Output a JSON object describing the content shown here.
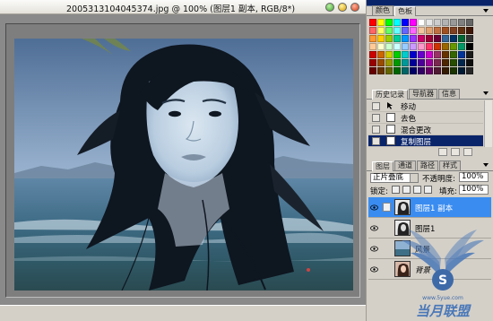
{
  "document": {
    "title": "2005313104045374.jpg @ 100% (图层1 副本, RGB/8*)"
  },
  "swatches_panel": {
    "tabs": [
      "颜色",
      "色板"
    ],
    "active_tab": "色板",
    "colors": [
      "#ff0000",
      "#ffff00",
      "#00ff00",
      "#00ffff",
      "#0000ff",
      "#ff00ff",
      "#ffffff",
      "#e6e6e6",
      "#cccccc",
      "#b3b3b3",
      "#999999",
      "#808080",
      "#666666",
      "#ff6666",
      "#ffff66",
      "#66ff66",
      "#66ffff",
      "#6666ff",
      "#ff66ff",
      "#f2c6a0",
      "#e0a070",
      "#c07040",
      "#a05020",
      "#804020",
      "#603010",
      "#401808",
      "#ff9933",
      "#ffcc00",
      "#99cc00",
      "#00cc99",
      "#0099ff",
      "#9933ff",
      "#cc0066",
      "#990033",
      "#660033",
      "#336699",
      "#003366",
      "#006633",
      "#333333",
      "#ffcc99",
      "#ffffcc",
      "#ccffcc",
      "#ccffff",
      "#99ccff",
      "#cc99ff",
      "#ff99cc",
      "#ff3366",
      "#cc3300",
      "#996600",
      "#669900",
      "#009966",
      "#000000",
      "#cc0000",
      "#cc6600",
      "#cccc00",
      "#00cc00",
      "#00cccc",
      "#0000cc",
      "#6600cc",
      "#cc00cc",
      "#993366",
      "#663300",
      "#336600",
      "#003399",
      "#1a1a1a",
      "#990000",
      "#994c00",
      "#999900",
      "#009900",
      "#009999",
      "#000099",
      "#4c0099",
      "#990099",
      "#7a2850",
      "#4d2600",
      "#264d00",
      "#00264d",
      "#0d0d0d",
      "#660000",
      "#663300",
      "#666600",
      "#006600",
      "#006666",
      "#000066",
      "#330066",
      "#660066",
      "#501a34",
      "#331a00",
      "#1a3300",
      "#001a33",
      "#262626"
    ]
  },
  "history_panel": {
    "tabs": [
      "历史记录",
      "导航器",
      "信息"
    ],
    "active_tab": "历史记录",
    "items": [
      {
        "label": "移动",
        "selected": false
      },
      {
        "label": "去色",
        "selected": false
      },
      {
        "label": "混合更改",
        "selected": false
      },
      {
        "label": "复制图层",
        "selected": true
      }
    ]
  },
  "layers_panel": {
    "tabs": [
      "图层",
      "通道",
      "路径",
      "样式"
    ],
    "active_tab": "图层",
    "blend_mode": "正片叠底",
    "opacity_label": "不透明度:",
    "opacity_value": "100%",
    "lock_label": "锁定:",
    "fill_label": "填充:",
    "fill_value": "100%",
    "layers": [
      {
        "name": "图层1 副本",
        "selected": true,
        "italic": false
      },
      {
        "name": "图层1",
        "selected": false,
        "italic": false
      },
      {
        "name": "风景",
        "selected": false,
        "italic": false
      },
      {
        "name": "背景",
        "selected": false,
        "italic": true
      }
    ]
  },
  "watermark": {
    "text": "当月联盟",
    "url": "www.5yue.com"
  }
}
